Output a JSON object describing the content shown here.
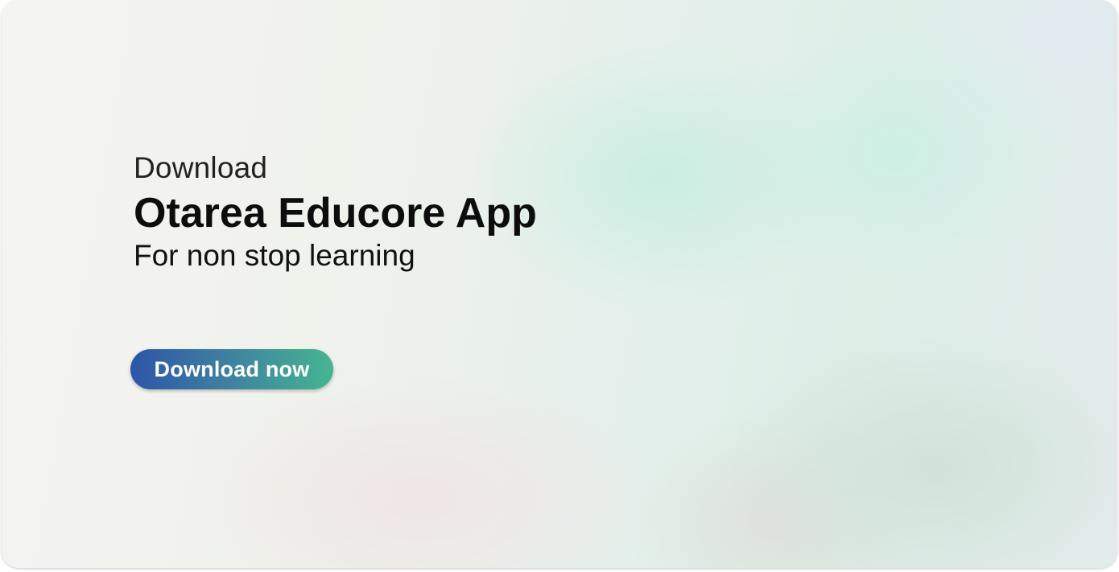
{
  "banner": {
    "kicker": "Download",
    "title": "Otarea Educore App",
    "subtitle": "For non stop learning",
    "cta_label": "Download now"
  },
  "colors": {
    "cta_gradient_start": "#2d55a8",
    "cta_gradient_end": "#46b591",
    "text": "#111111",
    "button_text": "#ffffff"
  }
}
